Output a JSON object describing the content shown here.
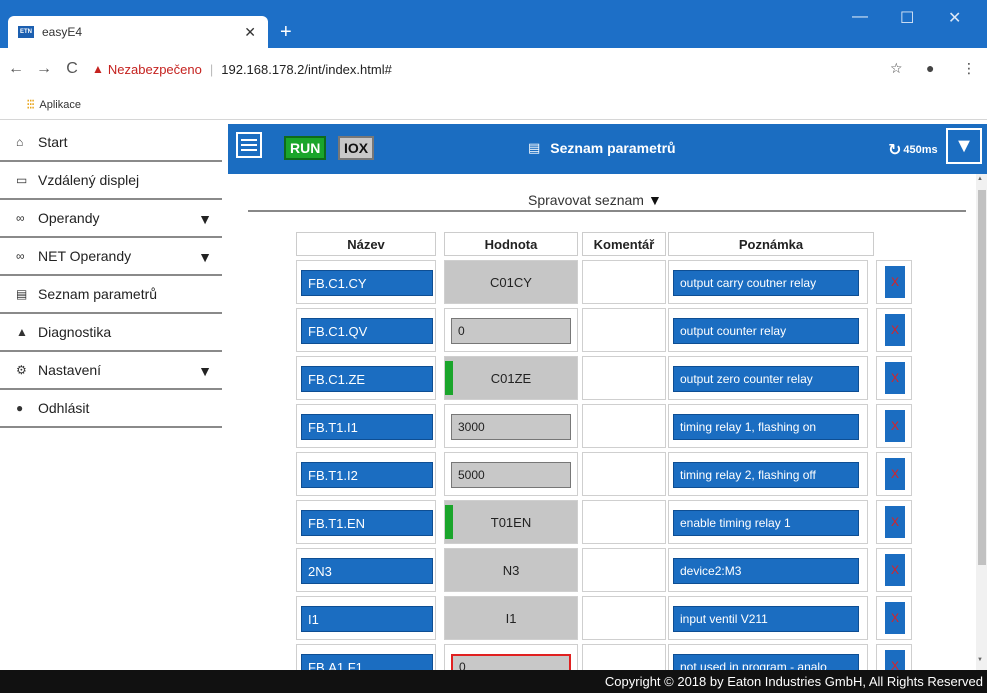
{
  "browser": {
    "tab_title": "easyE4",
    "favicon_text": "ETN",
    "close_glyph": "✕",
    "newtab_glyph": "+",
    "minimize_glyph": "—",
    "maximize_glyph": "☐",
    "window_close_glyph": "✕",
    "back_glyph": "←",
    "forward_glyph": "→",
    "reload_glyph": "C",
    "security_label": "Nezabezpečeno",
    "url": "192.168.178.2/int/index.html#",
    "bookmarks_label": "Aplikace",
    "star_glyph": "☆",
    "account_glyph": "●",
    "menu_glyph": "⋮"
  },
  "sidebar": {
    "items": [
      {
        "label": "Start",
        "icon": "home-icon",
        "glyph": "⌂",
        "has_arrow": false
      },
      {
        "label": "Vzdálený displej",
        "icon": "monitor-icon",
        "glyph": "▭",
        "has_arrow": false
      },
      {
        "label": "Operandy",
        "icon": "link-icon",
        "glyph": "∞",
        "has_arrow": true
      },
      {
        "label": "NET Operandy",
        "icon": "link-icon",
        "glyph": "∞",
        "has_arrow": true
      },
      {
        "label": "Seznam parametrů",
        "icon": "list-icon",
        "glyph": "▤",
        "has_arrow": false
      },
      {
        "label": "Diagnostika",
        "icon": "warning-icon",
        "glyph": "▲",
        "has_arrow": false
      },
      {
        "label": "Nastavení",
        "icon": "gear-icon",
        "glyph": "⚙",
        "has_arrow": true
      },
      {
        "label": "Odhlásit",
        "icon": "user-icon",
        "glyph": "●",
        "has_arrow": false
      }
    ],
    "arrow_glyph": "▼"
  },
  "header": {
    "run_badge": "RUN",
    "iox_badge": "IOX",
    "title": "Seznam parametrů",
    "title_icon_glyph": "▤",
    "cycle_time": "450ms",
    "cycle_icon_glyph": "↻",
    "dropdown_glyph": "▼"
  },
  "content": {
    "manage_label": "Spravovat seznam",
    "manage_glyph": "▼",
    "columns": [
      "Název",
      "Hodnota",
      "Komentář",
      "Poznámka"
    ],
    "delete_glyph": "X",
    "rows": [
      {
        "name": "FB.C1.CY",
        "value": "C01CY",
        "value_type": "gray",
        "green": false,
        "note": "output carry coutner relay"
      },
      {
        "name": "FB.C1.QV",
        "value": "0",
        "value_type": "input",
        "green": false,
        "note": "output counter relay"
      },
      {
        "name": "FB.C1.ZE",
        "value": "C01ZE",
        "value_type": "gray",
        "green": true,
        "note": "output zero counter relay"
      },
      {
        "name": "FB.T1.I1",
        "value": "3000",
        "value_type": "input",
        "green": false,
        "note": "timing relay 1, flashing on"
      },
      {
        "name": "FB.T1.I2",
        "value": "5000",
        "value_type": "input",
        "green": false,
        "note": "timing relay 2, flashing off"
      },
      {
        "name": "FB.T1.EN",
        "value": "T01EN",
        "value_type": "gray",
        "green": true,
        "note": "enable timing relay 1"
      },
      {
        "name": "2N3",
        "value": "N3",
        "value_type": "gray",
        "green": false,
        "note": "device2:M3"
      },
      {
        "name": "I1",
        "value": "I1",
        "value_type": "gray",
        "green": false,
        "note": "input ventil V211"
      },
      {
        "name": "FB.A1.F1",
        "value": "0",
        "value_type": "input-error",
        "green": false,
        "note": "not used in program - analo"
      }
    ]
  },
  "footer": {
    "copyright": "Copyright © 2018 by Eaton Industries GmbH, All Rights Reserved"
  },
  "colors": {
    "eaton_blue": "#1b6dc1",
    "run_green": "#1aa52b",
    "error_red": "#e02020"
  }
}
